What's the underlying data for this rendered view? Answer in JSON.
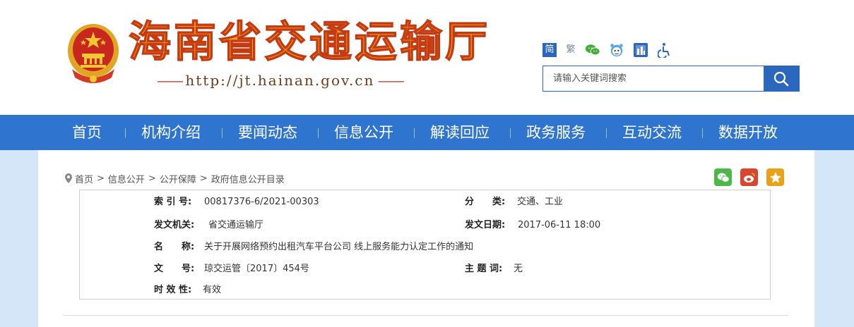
{
  "header": {
    "site_title": "海南省交通运输厅",
    "url_text": "http://jt.hainan.gov.cn",
    "url_dash_left": "—— ",
    "url_dash_right": " ——"
  },
  "utility": {
    "lang_simplified": "简",
    "lang_traditional": "繁",
    "icons": [
      "wechat-icon",
      "weibo-icon",
      "app-icon",
      "accessibility-icon"
    ]
  },
  "search": {
    "placeholder": "请输入关键词搜索"
  },
  "nav": {
    "items": [
      "首页",
      "机构介绍",
      "要闻动态",
      "信息公开",
      "解读回应",
      "政务服务",
      "互动交流",
      "数据开放"
    ]
  },
  "breadcrumb": {
    "items": [
      "首页",
      "信息公开",
      "公开保障",
      "政府信息公开目录"
    ],
    "separator": ">"
  },
  "share": {
    "icons": [
      "wechat-share-icon",
      "weibo-share-icon",
      "qzone-share-icon"
    ]
  },
  "info": {
    "index_label": "索 引 号:",
    "index_value": "00817376-6/2021-00303",
    "category_label": "分　　类:",
    "category_value": "交通、工业",
    "issuer_label": "发文机关:",
    "issuer_value": "省交通运输厅",
    "date_label": "发文日期:",
    "date_value": "2017-06-11 18:00",
    "name_label": "名　　称:",
    "name_value": "关于开展网络预约出租汽车平台公司 线上服务能力认定工作的通知",
    "doc_no_label": "文　　号:",
    "doc_no_value": "琼交运管〔2017〕454号",
    "subject_label": "主 题 词:",
    "subject_value": "无",
    "validity_label": "时 效 性:",
    "validity_value": "有效"
  },
  "colors": {
    "brand_blue": "#2f75cf",
    "title_orange": "#f4a21c",
    "title_red": "#c43a12",
    "page_bg": "#d4e6f8"
  }
}
